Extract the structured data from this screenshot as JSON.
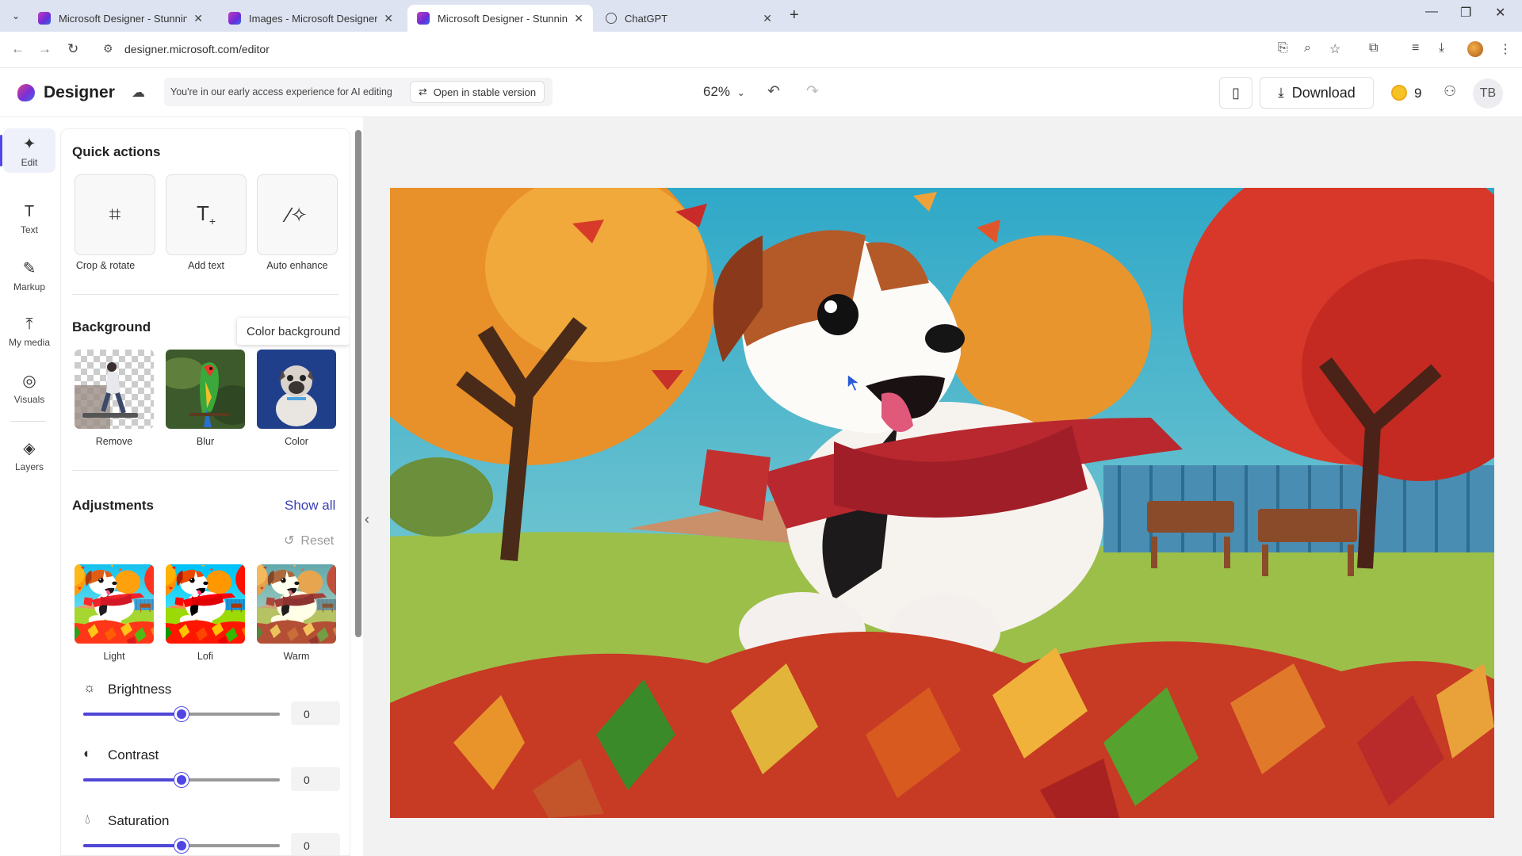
{
  "browser": {
    "tabs": [
      {
        "title": "Microsoft Designer - Stunning",
        "favicon": "designer-icon",
        "active": false
      },
      {
        "title": "Images - Microsoft Designer",
        "favicon": "designer-icon",
        "active": false
      },
      {
        "title": "Microsoft Designer - Stunning",
        "favicon": "designer-icon",
        "active": true
      },
      {
        "title": "ChatGPT",
        "favicon": "chatgpt-icon",
        "active": false
      }
    ],
    "url": "designer.microsoft.com/editor"
  },
  "header": {
    "brand": "Designer",
    "notice": "You're in our early access experience for AI editing",
    "stable_button": "Open in stable version",
    "zoom": "62%",
    "download_label": "Download",
    "coins": "9",
    "avatar_initials": "TB"
  },
  "rail": {
    "items": [
      {
        "label": "Edit",
        "icon": "sparkle-icon",
        "active": true
      },
      {
        "label": "Text",
        "icon": "text-icon",
        "active": false
      },
      {
        "label": "Markup",
        "icon": "pen-icon",
        "active": false
      },
      {
        "label": "My media",
        "icon": "upload-icon",
        "active": false
      },
      {
        "label": "Visuals",
        "icon": "shapes-icon",
        "active": false
      },
      {
        "label": "Layers",
        "icon": "layers-icon",
        "active": false
      }
    ]
  },
  "panel": {
    "quick_actions_title": "Quick actions",
    "quick_actions": [
      {
        "label": "Crop & rotate",
        "icon": "crop-icon"
      },
      {
        "label": "Add text",
        "icon": "add-text-icon"
      },
      {
        "label": "Auto enhance",
        "icon": "magic-wand-icon"
      }
    ],
    "background_title": "Background",
    "background_options": [
      {
        "label": "Remove"
      },
      {
        "label": "Blur"
      },
      {
        "label": "Color"
      }
    ],
    "tooltip": "Color background",
    "adjustments_title": "Adjustments",
    "show_all": "Show all",
    "reset": "Reset",
    "filters": [
      {
        "label": "Light"
      },
      {
        "label": "Lofi"
      },
      {
        "label": "Warm"
      }
    ],
    "sliders": [
      {
        "label": "Brightness",
        "icon": "sun-icon",
        "value": "0",
        "position": 0.5
      },
      {
        "label": "Contrast",
        "icon": "contrast-icon",
        "value": "0",
        "position": 0.5
      },
      {
        "label": "Saturation",
        "icon": "droplet-icon",
        "value": "0",
        "position": 0.5
      }
    ]
  },
  "colors": {
    "accent": "#4f46e5",
    "link": "#3a3fb5"
  }
}
